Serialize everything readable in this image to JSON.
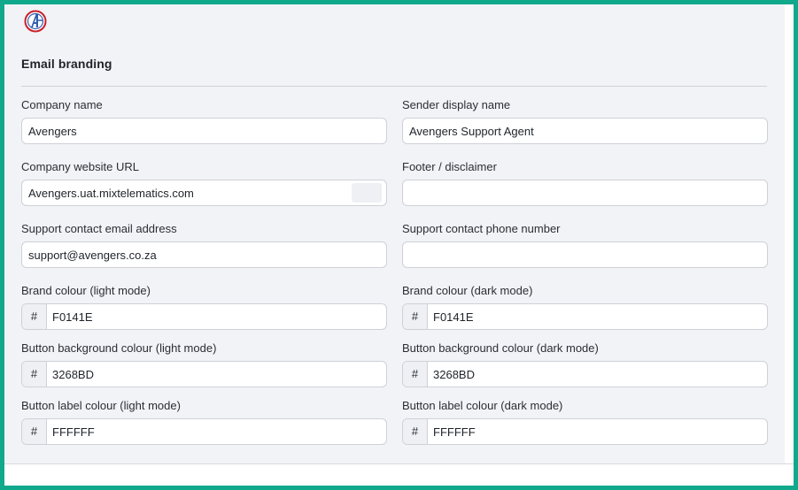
{
  "section": {
    "title": "Email branding"
  },
  "left": {
    "company_name": {
      "label": "Company name",
      "value": "Avengers"
    },
    "website_url": {
      "label": "Company website URL",
      "value": "Avengers.uat.mixtelematics.com"
    },
    "support_email": {
      "label": "Support contact email address",
      "value": "support@avengers.co.za"
    },
    "brand_colour": {
      "label": "Brand colour (light mode)",
      "prefix": "#",
      "value": "F0141E"
    },
    "button_bg_colour": {
      "label": "Button background colour (light mode)",
      "prefix": "#",
      "value": "3268BD"
    },
    "button_label_colour": {
      "label": "Button label colour (light mode)",
      "prefix": "#",
      "value": "FFFFFF"
    }
  },
  "right": {
    "sender_display_name": {
      "label": "Sender display name",
      "value": "Avengers Support Agent"
    },
    "footer_disclaimer": {
      "label": "Footer / disclaimer",
      "value": ""
    },
    "support_phone": {
      "label": "Support contact phone number",
      "value": ""
    },
    "brand_colour": {
      "label": "Brand colour (dark mode)",
      "prefix": "#",
      "value": "F0141E"
    },
    "button_bg_colour": {
      "label": "Button background colour (dark mode)",
      "prefix": "#",
      "value": "3268BD"
    },
    "button_label_colour": {
      "label": "Button label colour (dark mode)",
      "prefix": "#",
      "value": "FFFFFF"
    }
  },
  "colors": {
    "frame": "#10a98b",
    "logo_red": "#c8202a",
    "logo_blue": "#2f5fae"
  },
  "logo": {
    "icon": "avengers-logo-icon"
  }
}
